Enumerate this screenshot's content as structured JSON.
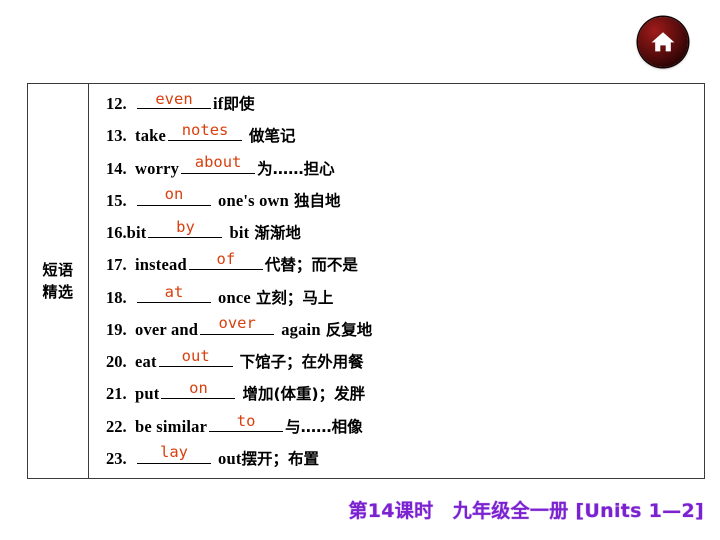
{
  "colors": {
    "answer": "#d8400f",
    "banner_text": "#7b22d0",
    "home_button": "#4d0a0a",
    "table_border": "#3a3a3a"
  },
  "home_button": {
    "icon": "home-icon",
    "label": "Home"
  },
  "table": {
    "category": {
      "line1": "短语",
      "line2": "精选"
    },
    "rows": [
      {
        "number": "12.",
        "before": "",
        "answer": "even",
        "after_en": "if",
        "after_cn": "即使",
        "answer_pos": "low"
      },
      {
        "number": "13.",
        "before": "take",
        "answer": "notes",
        "after_en": "",
        "after_cn": "做笔记",
        "answer_pos": "high"
      },
      {
        "number": "14.",
        "before": "worry",
        "answer": "about",
        "after_en": "",
        "after_cn": "为……担心",
        "answer_pos": "high"
      },
      {
        "number": "15.",
        "before": "",
        "answer": "on",
        "after_en": "one's own",
        "after_cn": "独自地",
        "answer_pos": "high"
      },
      {
        "number": "16.",
        "before": "bit",
        "answer": "by",
        "after_en": "bit",
        "after_cn": "渐渐地",
        "answer_pos": "high"
      },
      {
        "number": "17.",
        "before": "instead",
        "answer": "of",
        "after_en": "",
        "after_cn": "代替；而不是",
        "answer_pos": "high"
      },
      {
        "number": "18.",
        "before": "",
        "answer": "at",
        "after_en": "once",
        "after_cn": "立刻；马上",
        "answer_pos": "low"
      },
      {
        "number": "19.",
        "before": "over and",
        "answer": "over",
        "after_en": "again",
        "after_cn": "反复地",
        "answer_pos": "high"
      },
      {
        "number": "20.",
        "before": "eat",
        "answer": "out",
        "after_en": "",
        "after_cn": "下馆子；在外用餐",
        "answer_pos": "high"
      },
      {
        "number": "21.",
        "before": "put",
        "answer": "on",
        "after_en": "",
        "after_cn": "增加(体重)；发胖",
        "answer_pos": "high"
      },
      {
        "number": "22.",
        "before": "be similar",
        "answer": "to",
        "after_en": "",
        "after_cn": "与……相像",
        "answer_pos": "low"
      },
      {
        "number": "23.",
        "before": "",
        "answer": "lay",
        "after_en": "out",
        "after_cn": "摆开；布置",
        "answer_pos": "high"
      }
    ]
  },
  "banner": {
    "text": "第14课时　九年级全一册 [Units 1—2]"
  }
}
